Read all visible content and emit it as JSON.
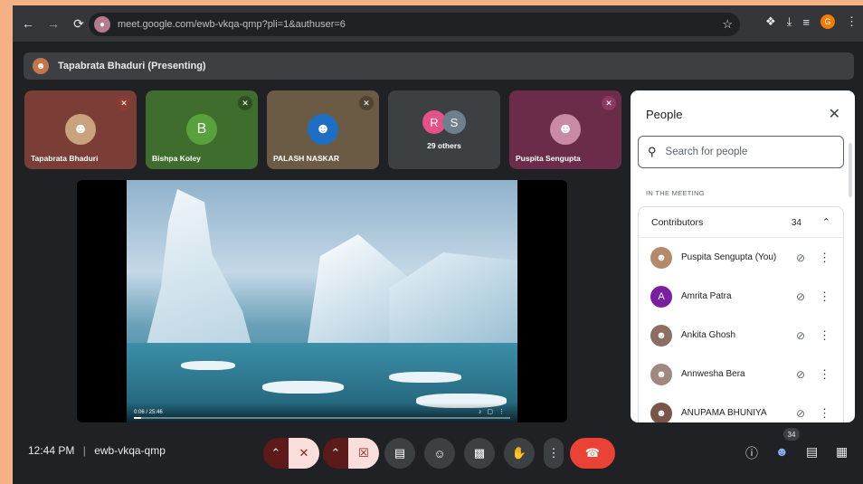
{
  "browser": {
    "url": "meet.google.com/ewb-vkqa-qmp?pli=1&authuser=6",
    "profile_initial": "G"
  },
  "presenting": {
    "text": "Tapabrata Bhaduri (Presenting)"
  },
  "tiles": [
    {
      "name": "Tapabrata Bhaduri"
    },
    {
      "name": "Bishpa Koley",
      "initial": "B"
    },
    {
      "name": "PALASH NASKAR"
    },
    {
      "name": "29 others",
      "initials": [
        "R",
        "S"
      ]
    },
    {
      "name": "Puspita Sengupta"
    }
  ],
  "video": {
    "time": "0:06 / 25:46",
    "progress": 0.02
  },
  "people": {
    "title": "People",
    "search_placeholder": "Search for people",
    "section": "IN THE MEETING",
    "group_label": "Contributors",
    "group_count": "34",
    "participants": [
      {
        "name": "Puspita Sengupta (You)",
        "color": "#b48a6a"
      },
      {
        "name": "Amrita Patra",
        "initial": "A",
        "color": "#7b1fa2"
      },
      {
        "name": "Ankita Ghosh",
        "color": "#8d6e63"
      },
      {
        "name": "Annwesha Bera",
        "color": "#a1887f"
      },
      {
        "name": "ANUPAMA BHUNIYA",
        "color": "#795548"
      }
    ]
  },
  "bottom": {
    "clock": "12:44 PM",
    "separator": "|",
    "meeting_code": "ewb-vkqa-qmp",
    "people_badge": "34"
  },
  "colors": {
    "end_call": "#ea4335",
    "mic_off_bg": "#f9dedc",
    "meet_bg": "#202124"
  }
}
